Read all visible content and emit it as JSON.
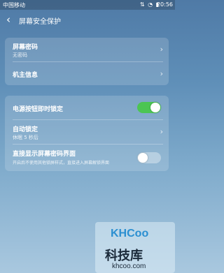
{
  "status_bar": {
    "carrier": "中国移动",
    "icons": "⇅ ◔ ▮",
    "time": "20:56"
  },
  "header": {
    "title": "屏幕安全保护"
  },
  "card1": {
    "screen_password": {
      "label": "屏幕密码",
      "sub": "无密码"
    },
    "owner_info": {
      "label": "机主信息"
    }
  },
  "card2": {
    "power_lock": {
      "label": "电源按钮即时锁定",
      "toggle": true
    },
    "auto_lock": {
      "label": "自动锁定",
      "sub": "休眠 5 秒后"
    },
    "direct_show": {
      "label": "直接显示屏幕密码界面",
      "sub": "开启后不使用其他锁屏样式，直接进入屏幕解锁界面",
      "toggle": false
    }
  },
  "colors": {
    "toggle_on": "#4cc553",
    "background_top": "#4f7aa6",
    "background_bottom": "#a9c8df"
  },
  "watermark": {
    "logo": "KHCoo",
    "text": "科技库",
    "url": "khcoo.com"
  }
}
